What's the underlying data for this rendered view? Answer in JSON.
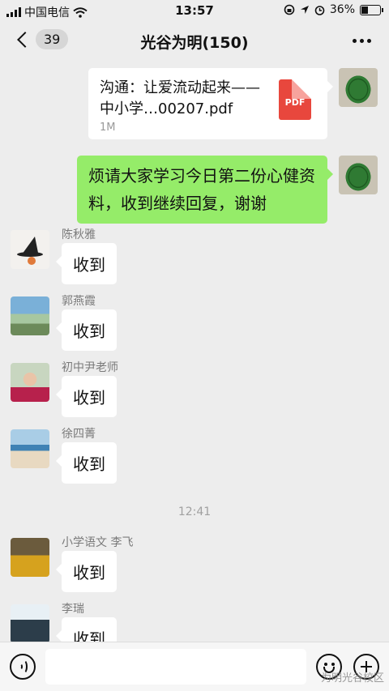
{
  "status_bar": {
    "carrier": "中国电信",
    "time": "13:57",
    "battery_text": "36%",
    "battery_level": 0.36
  },
  "nav": {
    "unread_count": "39",
    "title": "光谷为明(150)"
  },
  "file_message": {
    "name": "沟通：让爱流动起来——中小学…00207.pdf",
    "size": "1M",
    "icon_label": "PDF"
  },
  "text_message": {
    "text": "烦请大家学习今日第二份心健资料，收到继续回复，谢谢"
  },
  "replies": [
    {
      "sender": "陈秋雅",
      "text": "收到"
    },
    {
      "sender": "郭燕霞",
      "text": "收到"
    },
    {
      "sender": "初中尹老师",
      "text": "收到"
    },
    {
      "sender": "徐四菁",
      "text": "收到"
    },
    {
      "sender": "小学语文 李飞",
      "text": "收到"
    },
    {
      "sender": "李瑞",
      "text": "收到"
    }
  ],
  "time_divider": "12:41",
  "watermark": "为明光谷校区",
  "icons": [
    "signal-icon",
    "wifi-icon",
    "lock-rotation-icon",
    "location-icon",
    "alarm-icon",
    "battery-icon",
    "back-chevron-icon",
    "more-icon",
    "pdf-icon",
    "voice-icon",
    "emoji-icon",
    "plus-icon"
  ]
}
